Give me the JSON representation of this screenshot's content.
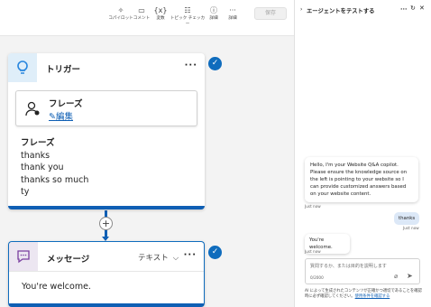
{
  "toolbar": {
    "items": [
      {
        "label": "コパイロット",
        "icon": "copilot-icon"
      },
      {
        "label": "コメント",
        "icon": "comment-icon"
      },
      {
        "label": "変数",
        "icon": "variable-icon"
      },
      {
        "label": "トピック チェッカー",
        "icon": "topic-checker-icon"
      },
      {
        "label": "詳細",
        "icon": "info-icon"
      },
      {
        "label": "詳細",
        "icon": "more-icon"
      }
    ],
    "save_label": "保存"
  },
  "trigger": {
    "title": "トリガー",
    "phrase_box_title": "フレーズ",
    "edit_label": "編集",
    "phrases_title": "フレーズ",
    "phrases": [
      "thanks",
      "thank you",
      "thanks so much",
      "ty"
    ]
  },
  "add_node": "+",
  "message": {
    "title": "メッセージ",
    "type_label": "テキスト",
    "text": "You're welcome."
  },
  "test_panel": {
    "title": "エージェントをテストする",
    "messages": [
      {
        "from": "bot",
        "text": "Hello, I'm your Website Q&A copilot. Please ensure the knowledge source on the left is pointing to your website so I can provide customized answers based on your website content.",
        "time": "Just now"
      },
      {
        "from": "user",
        "text": "thanks",
        "time": "Just now"
      },
      {
        "from": "bot",
        "text": "You're welcome.",
        "time": "Just now"
      }
    ],
    "input_placeholder": "質問するか、または目的を説明します",
    "char_count": "0/2000",
    "disclaimer": "AI によって生成されたコンテンツが正確かつ適切であることを確認時に必ず確認してください。",
    "terms_link": "使用条件を確認する"
  },
  "colors": {
    "accent": "#0f5fb4",
    "check": "#0f6cbd",
    "trigger_icon_bg": "#dfeef9",
    "message_icon_bg": "#ece6f1",
    "user_bubble": "#dce8f7"
  }
}
